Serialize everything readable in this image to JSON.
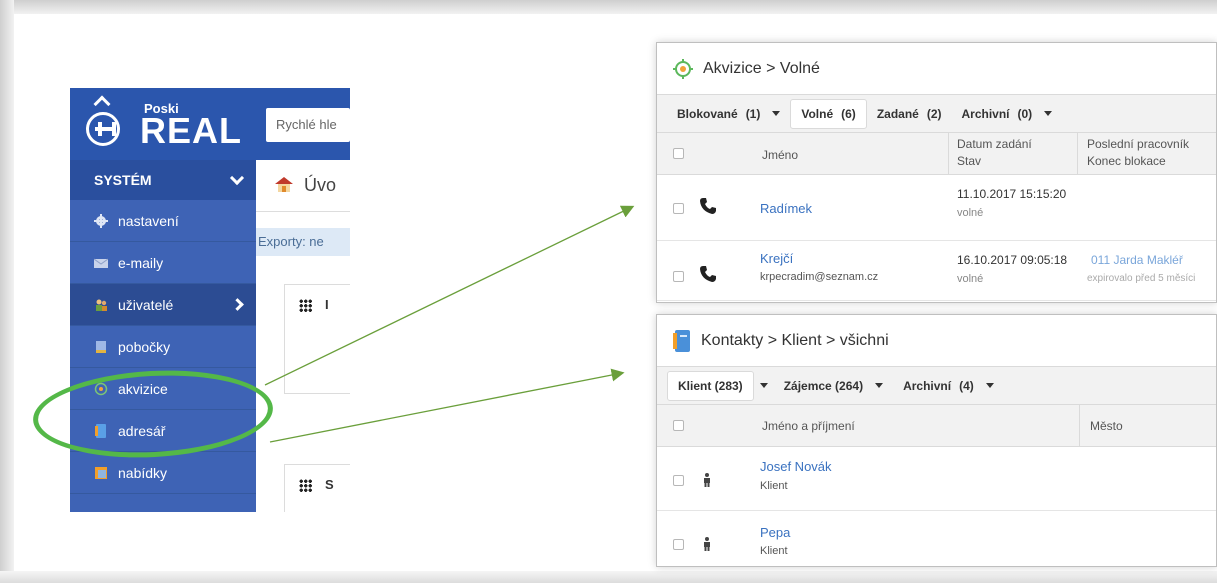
{
  "colors": {
    "sidebar": "#3e63b5",
    "highlight_green": "#54b848",
    "link_blue": "#3a72c0"
  },
  "app": {
    "logo": {
      "small": "Poski",
      "big": "REAL"
    },
    "search_placeholder": "Rychlé hle",
    "page_title": "Úvo",
    "exports_text": "Exporty: ne",
    "widgets": [
      {
        "letter": "I"
      },
      {
        "letter": "S"
      }
    ],
    "sidebar": {
      "section": "SYSTÉM",
      "items": [
        {
          "label": "nastavení",
          "icon": "gear-icon"
        },
        {
          "label": "e-maily",
          "icon": "envelope-icon"
        },
        {
          "label": "uživatelé",
          "icon": "users-icon"
        },
        {
          "label": "pobočky",
          "icon": "branch-icon"
        },
        {
          "label": "akvizice",
          "icon": "target-icon"
        },
        {
          "label": "adresář",
          "icon": "address-book-icon"
        },
        {
          "label": "nabídky",
          "icon": "offers-icon"
        }
      ]
    }
  },
  "akvizice": {
    "breadcrumb": "Akvizice > Volné",
    "tabs": [
      {
        "label": "Blokované",
        "count": "(1)"
      },
      {
        "label": "Volné",
        "count": "(6)"
      },
      {
        "label": "Zadané",
        "count": "(2)"
      },
      {
        "label": "Archivní",
        "count": "(0)"
      }
    ],
    "columns": {
      "name": "Jméno",
      "date": "Datum zadání",
      "state": "Stav",
      "last_worker": "Poslední pracovník",
      "block_end": "Konec blokace"
    },
    "rows": [
      {
        "name": "Radímek",
        "email": "",
        "date": "11.10.2017 15:15:20",
        "state": "volné",
        "worker": "",
        "block": ""
      },
      {
        "name": "Krejčí",
        "email": "krpecradim@seznam.cz",
        "date": "16.10.2017 09:05:18",
        "state": "volné",
        "worker": "011 Jarda Makléř",
        "block": "expirovalo před 5 měsíci"
      }
    ]
  },
  "kontakty": {
    "breadcrumb": "Kontakty > Klient > všichni",
    "tabs": [
      {
        "label": "Klient (283)"
      },
      {
        "label": "Zájemce (264)"
      },
      {
        "label": "Archivní",
        "count": "(4)"
      }
    ],
    "columns": {
      "name": "Jméno a příjmení",
      "city": "Město"
    },
    "rows": [
      {
        "name": "Josef Novák",
        "type": "Klient"
      },
      {
        "name": "Pepa",
        "type": "Klient"
      }
    ]
  }
}
